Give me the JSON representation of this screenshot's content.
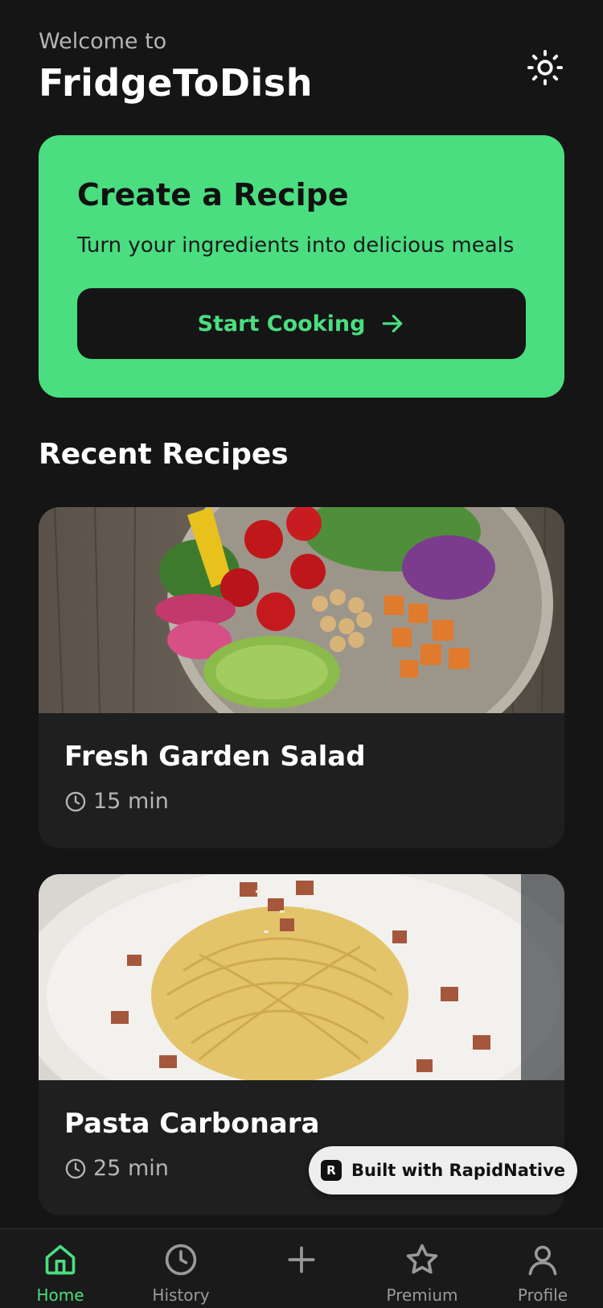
{
  "header": {
    "welcome": "Welcome to",
    "app_title": "FridgeToDish",
    "theme_icon": "sun-icon"
  },
  "cta": {
    "title": "Create a Recipe",
    "subtitle": "Turn your ingredients into delicious meals",
    "button_label": "Start Cooking",
    "button_icon": "arrow-right-icon"
  },
  "recent": {
    "title": "Recent Recipes",
    "items": [
      {
        "name": "Fresh Garden Salad",
        "time": "15 min",
        "image": "salad-bowl-photo"
      },
      {
        "name": "Pasta Carbonara",
        "time": "25 min",
        "image": "pasta-carbonara-photo"
      }
    ]
  },
  "badge": {
    "label": "Built with RapidNative"
  },
  "tabs": [
    {
      "label": "Home",
      "icon": "home-icon",
      "active": true
    },
    {
      "label": "History",
      "icon": "clock-icon",
      "active": false
    },
    {
      "label": "",
      "icon": "plus-icon",
      "active": false
    },
    {
      "label": "Premium",
      "icon": "star-icon",
      "active": false
    },
    {
      "label": "Profile",
      "icon": "user-icon",
      "active": false
    }
  ],
  "colors": {
    "background": "#151515",
    "accent": "#4ade80",
    "card": "#1f1f1f",
    "muted_text": "#b5b5b5"
  }
}
